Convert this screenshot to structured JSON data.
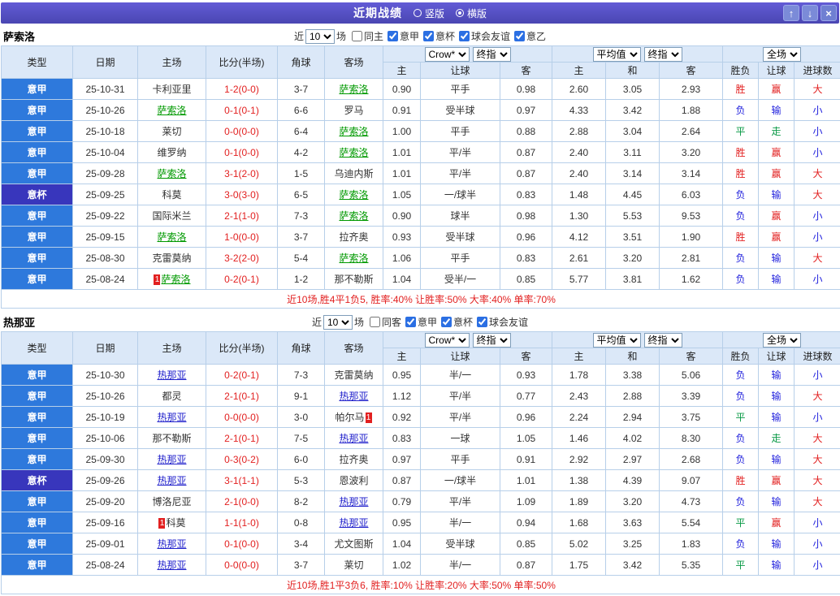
{
  "titlebar": {
    "title": "近期战绩",
    "radios": [
      {
        "label": "竖版",
        "selected": false
      },
      {
        "label": "横版",
        "selected": true
      }
    ],
    "buttons": [
      {
        "glyph": "↑"
      },
      {
        "glyph": "↓"
      },
      {
        "glyph": "×"
      }
    ]
  },
  "sections": [
    {
      "team": "萨索洛",
      "hl": "g",
      "filter": {
        "near_label": "近",
        "count": "10",
        "games_label": "场",
        "checkboxes": [
          {
            "label": "同主",
            "checked": false
          },
          {
            "label": "意甲",
            "checked": true
          },
          {
            "label": "意杯",
            "checked": true
          },
          {
            "label": "球会友谊",
            "checked": true
          },
          {
            "label": "意乙",
            "checked": true
          }
        ]
      },
      "header": {
        "type": "类型",
        "date": "日期",
        "home": "主场",
        "score": "比分(半场)",
        "corner": "角球",
        "away": "客场",
        "dd_odds_source": "Crow*",
        "dd_odds_time": "终指",
        "dd_avg": "平均值",
        "dd_avg_time": "终指",
        "dd_scope": "全场",
        "sub": [
          "主",
          "让球",
          "客",
          "主",
          "和",
          "客",
          "胜负",
          "让球",
          "进球数"
        ]
      },
      "rows": [
        {
          "league": "意甲",
          "cup": false,
          "date": "25-10-31",
          "home": {
            "name": "卡利亚里"
          },
          "score": "1-2(0-0)",
          "corner": "3-7",
          "away": {
            "name": "萨索洛",
            "hl": true
          },
          "odds": [
            "0.90",
            "平手",
            "0.98",
            "2.60",
            "3.05",
            "2.93"
          ],
          "results": [
            {
              "t": "胜",
              "c": "r"
            },
            {
              "t": "赢",
              "c": "r"
            },
            {
              "t": "大",
              "c": "r"
            }
          ]
        },
        {
          "league": "意甲",
          "cup": false,
          "date": "25-10-26",
          "home": {
            "name": "萨索洛",
            "hl": true
          },
          "score": "0-1(0-1)",
          "corner": "6-6",
          "away": {
            "name": "罗马"
          },
          "odds": [
            "0.91",
            "受半球",
            "0.97",
            "4.33",
            "3.42",
            "1.88"
          ],
          "results": [
            {
              "t": "负",
              "c": "b"
            },
            {
              "t": "输",
              "c": "b"
            },
            {
              "t": "小",
              "c": "b"
            }
          ]
        },
        {
          "league": "意甲",
          "cup": false,
          "date": "25-10-18",
          "home": {
            "name": "莱切"
          },
          "score": "0-0(0-0)",
          "corner": "6-4",
          "away": {
            "name": "萨索洛",
            "hl": true
          },
          "odds": [
            "1.00",
            "平手",
            "0.88",
            "2.88",
            "3.04",
            "2.64"
          ],
          "results": [
            {
              "t": "平",
              "c": "g"
            },
            {
              "t": "走",
              "c": "g"
            },
            {
              "t": "小",
              "c": "b"
            }
          ]
        },
        {
          "league": "意甲",
          "cup": false,
          "date": "25-10-04",
          "home": {
            "name": "维罗纳"
          },
          "score": "0-1(0-0)",
          "corner": "4-2",
          "away": {
            "name": "萨索洛",
            "hl": true
          },
          "odds": [
            "1.01",
            "平/半",
            "0.87",
            "2.40",
            "3.11",
            "3.20"
          ],
          "results": [
            {
              "t": "胜",
              "c": "r"
            },
            {
              "t": "赢",
              "c": "r"
            },
            {
              "t": "小",
              "c": "b"
            }
          ]
        },
        {
          "league": "意甲",
          "cup": false,
          "date": "25-09-28",
          "home": {
            "name": "萨索洛",
            "hl": true
          },
          "score": "3-1(2-0)",
          "corner": "1-5",
          "away": {
            "name": "乌迪内斯"
          },
          "odds": [
            "1.01",
            "平/半",
            "0.87",
            "2.40",
            "3.14",
            "3.14"
          ],
          "results": [
            {
              "t": "胜",
              "c": "r"
            },
            {
              "t": "赢",
              "c": "r"
            },
            {
              "t": "大",
              "c": "r"
            }
          ]
        },
        {
          "league": "意杯",
          "cup": true,
          "date": "25-09-25",
          "home": {
            "name": "科莫"
          },
          "score": "3-0(3-0)",
          "corner": "6-5",
          "away": {
            "name": "萨索洛",
            "hl": true
          },
          "odds": [
            "1.05",
            "一/球半",
            "0.83",
            "1.48",
            "4.45",
            "6.03"
          ],
          "results": [
            {
              "t": "负",
              "c": "b"
            },
            {
              "t": "输",
              "c": "b"
            },
            {
              "t": "大",
              "c": "r"
            }
          ]
        },
        {
          "league": "意甲",
          "cup": false,
          "date": "25-09-22",
          "home": {
            "name": "国际米兰"
          },
          "score": "2-1(1-0)",
          "corner": "7-3",
          "away": {
            "name": "萨索洛",
            "hl": true
          },
          "odds": [
            "0.90",
            "球半",
            "0.98",
            "1.30",
            "5.53",
            "9.53"
          ],
          "results": [
            {
              "t": "负",
              "c": "b"
            },
            {
              "t": "赢",
              "c": "r"
            },
            {
              "t": "小",
              "c": "b"
            }
          ]
        },
        {
          "league": "意甲",
          "cup": false,
          "date": "25-09-15",
          "home": {
            "name": "萨索洛",
            "hl": true
          },
          "score": "1-0(0-0)",
          "corner": "3-7",
          "away": {
            "name": "拉齐奥"
          },
          "odds": [
            "0.93",
            "受半球",
            "0.96",
            "4.12",
            "3.51",
            "1.90"
          ],
          "results": [
            {
              "t": "胜",
              "c": "r"
            },
            {
              "t": "赢",
              "c": "r"
            },
            {
              "t": "小",
              "c": "b"
            }
          ]
        },
        {
          "league": "意甲",
          "cup": false,
          "date": "25-08-30",
          "home": {
            "name": "克雷莫纳"
          },
          "score": "3-2(2-0)",
          "corner": "5-4",
          "away": {
            "name": "萨索洛",
            "hl": true
          },
          "odds": [
            "1.06",
            "平手",
            "0.83",
            "2.61",
            "3.20",
            "2.81"
          ],
          "results": [
            {
              "t": "负",
              "c": "b"
            },
            {
              "t": "输",
              "c": "b"
            },
            {
              "t": "大",
              "c": "r"
            }
          ]
        },
        {
          "league": "意甲",
          "cup": false,
          "date": "25-08-24",
          "home": {
            "name": "萨索洛",
            "hl": true,
            "card": "pre"
          },
          "score": "0-2(0-1)",
          "corner": "1-2",
          "away": {
            "name": "那不勒斯"
          },
          "odds": [
            "1.04",
            "受半/一",
            "0.85",
            "5.77",
            "3.81",
            "1.62"
          ],
          "results": [
            {
              "t": "负",
              "c": "b"
            },
            {
              "t": "输",
              "c": "b"
            },
            {
              "t": "小",
              "c": "b"
            }
          ]
        }
      ],
      "footer": "近10场,胜4平1负5, 胜率:40% 让胜率:50% 大率:40% 单率:70%"
    },
    {
      "team": "热那亚",
      "hl": "b",
      "filter": {
        "near_label": "近",
        "count": "10",
        "games_label": "场",
        "checkboxes": [
          {
            "label": "同客",
            "checked": false
          },
          {
            "label": "意甲",
            "checked": true
          },
          {
            "label": "意杯",
            "checked": true
          },
          {
            "label": "球会友谊",
            "checked": true
          }
        ]
      },
      "header": {
        "type": "类型",
        "date": "日期",
        "home": "主场",
        "score": "比分(半场)",
        "corner": "角球",
        "away": "客场",
        "dd_odds_source": "Crow*",
        "dd_odds_time": "终指",
        "dd_avg": "平均值",
        "dd_avg_time": "终指",
        "dd_scope": "全场",
        "sub": [
          "主",
          "让球",
          "客",
          "主",
          "和",
          "客",
          "胜负",
          "让球",
          "进球数"
        ]
      },
      "rows": [
        {
          "league": "意甲",
          "cup": false,
          "date": "25-10-30",
          "home": {
            "name": "热那亚",
            "hl": true
          },
          "score": "0-2(0-1)",
          "corner": "7-3",
          "away": {
            "name": "克雷莫纳"
          },
          "odds": [
            "0.95",
            "半/一",
            "0.93",
            "1.78",
            "3.38",
            "5.06"
          ],
          "results": [
            {
              "t": "负",
              "c": "b"
            },
            {
              "t": "输",
              "c": "b"
            },
            {
              "t": "小",
              "c": "b"
            }
          ]
        },
        {
          "league": "意甲",
          "cup": false,
          "date": "25-10-26",
          "home": {
            "name": "都灵"
          },
          "score": "2-1(0-1)",
          "corner": "9-1",
          "away": {
            "name": "热那亚",
            "hl": true
          },
          "odds": [
            "1.12",
            "平/半",
            "0.77",
            "2.43",
            "2.88",
            "3.39"
          ],
          "results": [
            {
              "t": "负",
              "c": "b"
            },
            {
              "t": "输",
              "c": "b"
            },
            {
              "t": "大",
              "c": "r"
            }
          ]
        },
        {
          "league": "意甲",
          "cup": false,
          "date": "25-10-19",
          "home": {
            "name": "热那亚",
            "hl": true
          },
          "score": "0-0(0-0)",
          "corner": "3-0",
          "away": {
            "name": "帕尔马",
            "card": "post"
          },
          "odds": [
            "0.92",
            "平/半",
            "0.96",
            "2.24",
            "2.94",
            "3.75"
          ],
          "results": [
            {
              "t": "平",
              "c": "g"
            },
            {
              "t": "输",
              "c": "b"
            },
            {
              "t": "小",
              "c": "b"
            }
          ]
        },
        {
          "league": "意甲",
          "cup": false,
          "date": "25-10-06",
          "home": {
            "name": "那不勒斯"
          },
          "score": "2-1(0-1)",
          "corner": "7-5",
          "away": {
            "name": "热那亚",
            "hl": true
          },
          "odds": [
            "0.83",
            "一球",
            "1.05",
            "1.46",
            "4.02",
            "8.30"
          ],
          "results": [
            {
              "t": "负",
              "c": "b"
            },
            {
              "t": "走",
              "c": "g"
            },
            {
              "t": "大",
              "c": "r"
            }
          ]
        },
        {
          "league": "意甲",
          "cup": false,
          "date": "25-09-30",
          "home": {
            "name": "热那亚",
            "hl": true
          },
          "score": "0-3(0-2)",
          "corner": "6-0",
          "away": {
            "name": "拉齐奥"
          },
          "odds": [
            "0.97",
            "平手",
            "0.91",
            "2.92",
            "2.97",
            "2.68"
          ],
          "results": [
            {
              "t": "负",
              "c": "b"
            },
            {
              "t": "输",
              "c": "b"
            },
            {
              "t": "大",
              "c": "r"
            }
          ]
        },
        {
          "league": "意杯",
          "cup": true,
          "date": "25-09-26",
          "home": {
            "name": "热那亚",
            "hl": true
          },
          "score": "3-1(1-1)",
          "corner": "5-3",
          "away": {
            "name": "恩波利"
          },
          "odds": [
            "0.87",
            "一/球半",
            "1.01",
            "1.38",
            "4.39",
            "9.07"
          ],
          "results": [
            {
              "t": "胜",
              "c": "r"
            },
            {
              "t": "赢",
              "c": "r"
            },
            {
              "t": "大",
              "c": "r"
            }
          ]
        },
        {
          "league": "意甲",
          "cup": false,
          "date": "25-09-20",
          "home": {
            "name": "博洛尼亚"
          },
          "score": "2-1(0-0)",
          "corner": "8-2",
          "away": {
            "name": "热那亚",
            "hl": true
          },
          "odds": [
            "0.79",
            "平/半",
            "1.09",
            "1.89",
            "3.20",
            "4.73"
          ],
          "results": [
            {
              "t": "负",
              "c": "b"
            },
            {
              "t": "输",
              "c": "b"
            },
            {
              "t": "大",
              "c": "r"
            }
          ]
        },
        {
          "league": "意甲",
          "cup": false,
          "date": "25-09-16",
          "home": {
            "name": "科莫",
            "card": "pre"
          },
          "score": "1-1(1-0)",
          "corner": "0-8",
          "away": {
            "name": "热那亚",
            "hl": true
          },
          "odds": [
            "0.95",
            "半/一",
            "0.94",
            "1.68",
            "3.63",
            "5.54"
          ],
          "results": [
            {
              "t": "平",
              "c": "g"
            },
            {
              "t": "赢",
              "c": "r"
            },
            {
              "t": "小",
              "c": "b"
            }
          ]
        },
        {
          "league": "意甲",
          "cup": false,
          "date": "25-09-01",
          "home": {
            "name": "热那亚",
            "hl": true
          },
          "score": "0-1(0-0)",
          "corner": "3-4",
          "away": {
            "name": "尤文图斯"
          },
          "odds": [
            "1.04",
            "受半球",
            "0.85",
            "5.02",
            "3.25",
            "1.83"
          ],
          "results": [
            {
              "t": "负",
              "c": "b"
            },
            {
              "t": "输",
              "c": "b"
            },
            {
              "t": "小",
              "c": "b"
            }
          ]
        },
        {
          "league": "意甲",
          "cup": false,
          "date": "25-08-24",
          "home": {
            "name": "热那亚",
            "hl": true
          },
          "score": "0-0(0-0)",
          "corner": "3-7",
          "away": {
            "name": "莱切"
          },
          "odds": [
            "1.02",
            "半/一",
            "0.87",
            "1.75",
            "3.42",
            "5.35"
          ],
          "results": [
            {
              "t": "平",
              "c": "g"
            },
            {
              "t": "输",
              "c": "b"
            },
            {
              "t": "小",
              "c": "b"
            }
          ]
        }
      ],
      "footer": "近10场,胜1平3负6, 胜率:10% 让胜率:20% 大率:50% 单率:50%"
    }
  ]
}
